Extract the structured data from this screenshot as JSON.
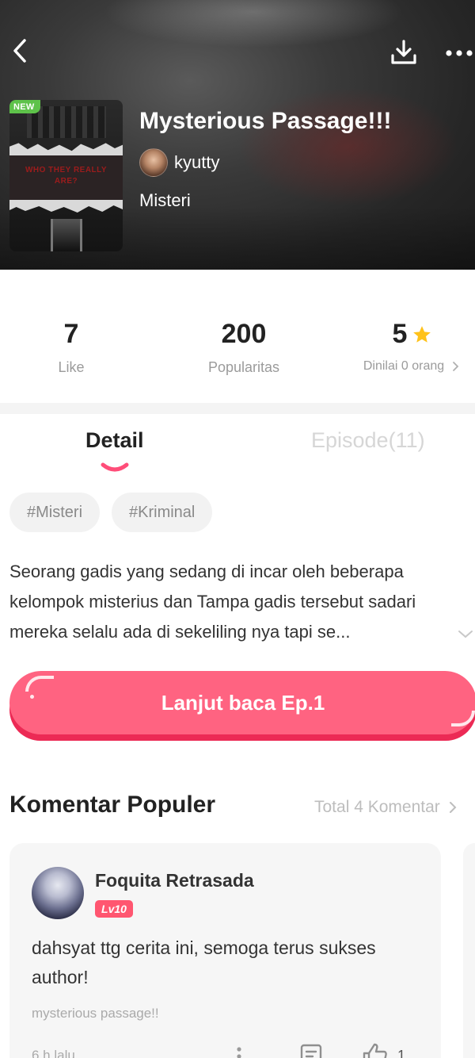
{
  "header": {
    "new_badge": "NEW",
    "title": "Mysterious Passage!!!",
    "author": "kyutty",
    "genre": "Misteri",
    "cover_text": "WHO THEY REALLY ARE?"
  },
  "stats": {
    "likes": "7",
    "likes_label": "Like",
    "popularity": "200",
    "popularity_label": "Popularitas",
    "rating": "5",
    "rating_label": "Dinilai 0 orang"
  },
  "tabs": {
    "detail": "Detail",
    "episode": "Episode(11)"
  },
  "tags": [
    "#Misteri",
    "#Kriminal"
  ],
  "description": "Seorang gadis yang sedang di incar oleh beberapa kelompok misterius dan Tampa gadis tersebut sadari mereka selalu ada di sekeliling nya tapi se...",
  "cta": {
    "label": "Lanjut baca Ep.1"
  },
  "comments": {
    "section_title": "Komentar Populer",
    "total_label": "Total 4 Komentar",
    "items": [
      {
        "user": "Foquita Retrasada",
        "level": "Lv10",
        "text": "dahsyat ttg cerita ini, semoga terus sukses author!",
        "ref": "mysterious passage!!",
        "time": "6 h lalu",
        "likes": "1"
      }
    ]
  },
  "colors": {
    "accent": "#ff6381",
    "accent_dark": "#ec2a55",
    "new_badge": "#5ec24a",
    "star": "#ffc21a",
    "level_badge": "#ff5670"
  },
  "icons": {
    "back": "chevron-left-icon",
    "download": "download-icon",
    "more": "more-dots-icon",
    "star": "star-icon",
    "chevron": "chevron-right-icon",
    "expand": "chevron-down-icon",
    "reply": "comment-icon",
    "like": "thumbs-up-icon"
  }
}
